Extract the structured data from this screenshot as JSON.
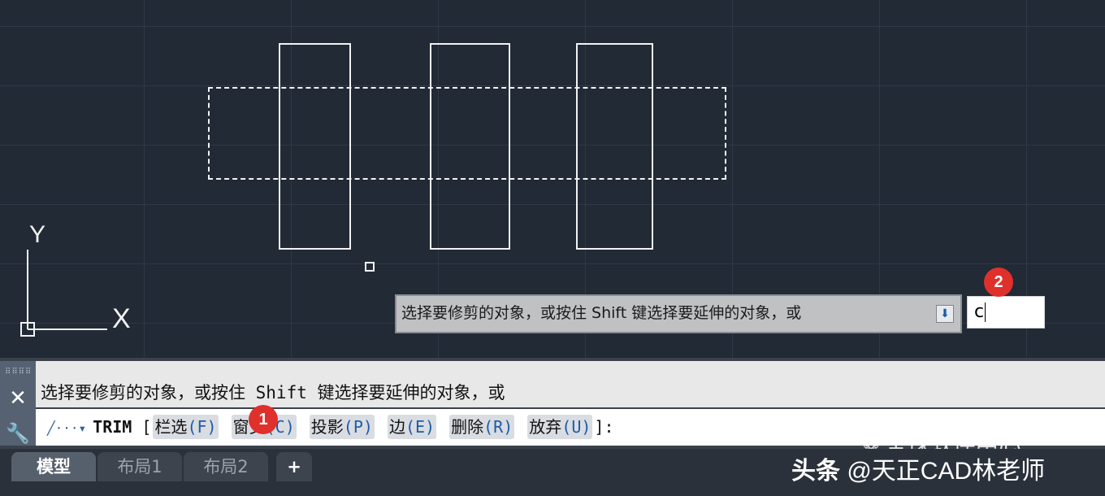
{
  "canvas": {
    "ucs": {
      "y_label": "Y",
      "x_label": "X"
    }
  },
  "tooltip": {
    "text": "选择要修剪的对象，或按住 Shift 键选择要延伸的对象，或",
    "button_icon": "download-arrow-icon"
  },
  "dynamic_input": {
    "value": "c"
  },
  "badges": {
    "one": "1",
    "two": "2"
  },
  "command": {
    "history_text": "选择要修剪的对象，或按住 Shift 键选择要延伸的对象，或",
    "command_name": "TRIM",
    "open_bracket": "[",
    "close_bracket": "]:",
    "options": [
      {
        "label": "栏选",
        "key": "(F)"
      },
      {
        "label": "窗交",
        "key": "(C)"
      },
      {
        "label": "投影",
        "key": "(P)"
      },
      {
        "label": "边",
        "key": "(E)"
      },
      {
        "label": "删除",
        "key": "(R)"
      },
      {
        "label": "放弃",
        "key": "(U)"
      }
    ]
  },
  "tabs": [
    {
      "label": "模型"
    },
    {
      "label": "布局1"
    },
    {
      "label": "布局2"
    },
    {
      "label": "+"
    }
  ],
  "watermark": {
    "channel": "全球软件中心",
    "platform": "头条",
    "author": "@天正CAD林老师"
  },
  "colors": {
    "canvas_bg": "#212a35",
    "grid": "#2f3947",
    "geometry": "#f2f2f2",
    "badge": "#e0302c",
    "option_key": "#1e5aa8"
  }
}
